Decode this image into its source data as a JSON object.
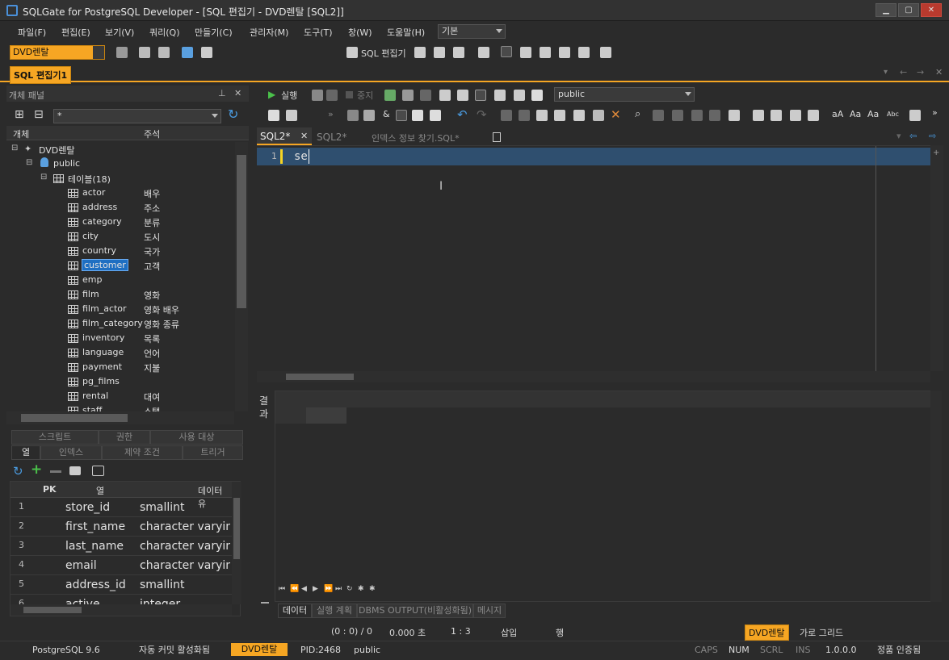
{
  "window": {
    "title": "SQLGate for PostgreSQL Developer - [SQL 편집기 - DVD렌탈 [SQL2]]",
    "buttons": {
      "minimize": "▁",
      "maximize": "▢",
      "close": "✕"
    }
  },
  "menu": {
    "items": [
      "파일(F)",
      "편집(E)",
      "보기(V)",
      "쿼리(Q)",
      "만들기(C)",
      "관리자(M)",
      "도구(T)",
      "창(W)",
      "도움말(H)"
    ],
    "layout_combo": "기본"
  },
  "toolbar": {
    "connection": "DVD렌탈",
    "sql_editor_label": "SQL 편집기"
  },
  "doc_tab": {
    "label": "SQL 편집기1"
  },
  "object_panel": {
    "title": "개체 패널",
    "filter": "*",
    "col_object": "개체",
    "col_comment": "주석",
    "tree_root": "DVD렌탈",
    "schema": "public",
    "tables_node": "테이블(18)",
    "tables": [
      {
        "name": "actor",
        "comment": "배우"
      },
      {
        "name": "address",
        "comment": "주소"
      },
      {
        "name": "category",
        "comment": "분류"
      },
      {
        "name": "city",
        "comment": "도시"
      },
      {
        "name": "country",
        "comment": "국가"
      },
      {
        "name": "customer",
        "comment": "고객"
      },
      {
        "name": "emp",
        "comment": ""
      },
      {
        "name": "film",
        "comment": "영화"
      },
      {
        "name": "film_actor",
        "comment": "영화 배우"
      },
      {
        "name": "film_category",
        "comment": "영화 종류"
      },
      {
        "name": "inventory",
        "comment": "목록"
      },
      {
        "name": "language",
        "comment": "언어"
      },
      {
        "name": "payment",
        "comment": "지불"
      },
      {
        "name": "pg_films",
        "comment": ""
      },
      {
        "name": "rental",
        "comment": "대여"
      },
      {
        "name": "staff",
        "comment": "스탭"
      }
    ],
    "selected": "customer"
  },
  "detail_tabs": {
    "row1": [
      "스크립트",
      "권한",
      "사용 대상"
    ],
    "row2": [
      "열",
      "인덱스",
      "제약 조건",
      "트리거"
    ]
  },
  "columns_grid": {
    "headers": [
      "PK",
      "열",
      "데이터 유"
    ],
    "rows": [
      {
        "num": "1",
        "name": "store_id",
        "type": "smallint"
      },
      {
        "num": "2",
        "name": "first_name",
        "type": "character varying"
      },
      {
        "num": "3",
        "name": "last_name",
        "type": "character varying"
      },
      {
        "num": "4",
        "name": "email",
        "type": "character varying"
      },
      {
        "num": "5",
        "name": "address_id",
        "type": "smallint"
      },
      {
        "num": "6",
        "name": "active",
        "type": "integer"
      }
    ]
  },
  "editor_toolbar": {
    "run": "실행",
    "stop": "중지",
    "schema": "public"
  },
  "editor_tabs": [
    {
      "label": "SQL2*",
      "active": true
    },
    {
      "label": "SQL2*",
      "active": false
    },
    {
      "label": "인덱스 정보 찾기.SQL*",
      "active": false
    }
  ],
  "editor": {
    "line_number": "1",
    "text": "se"
  },
  "result": {
    "side_label_1": "결",
    "side_label_2": "과",
    "tabs": [
      "데이터",
      "실행 계획",
      "DBMS OUTPUT(비활성화됨)",
      "메시지"
    ],
    "nav": [
      "⏮",
      "⏪",
      "◀",
      "▶",
      "⏩",
      "⏭",
      "↻",
      "✱",
      "✱"
    ]
  },
  "status_top": {
    "pos": "(0 : 0) / 0",
    "time": "0.000 초",
    "cursor": "1 : 3",
    "mode": "삽입",
    "row_label": "행",
    "conn": "DVD렌탈",
    "grid": "가로 그리드"
  },
  "status_bottom": {
    "db": "PostgreSQL 9.6",
    "autocommit": "자동 커밋 활성화됨",
    "conn": "DVD렌탈",
    "pid": "PID:2468",
    "schema": "public",
    "caps": "CAPS",
    "num": "NUM",
    "scrl": "SCRL",
    "ins": "INS",
    "version": "1.0.0.0",
    "license": "정품 인증됨"
  },
  "colors": {
    "accent_orange": "#f6a623",
    "selection_blue": "#1e6fc2",
    "editor_line": "#2f4f6f"
  }
}
